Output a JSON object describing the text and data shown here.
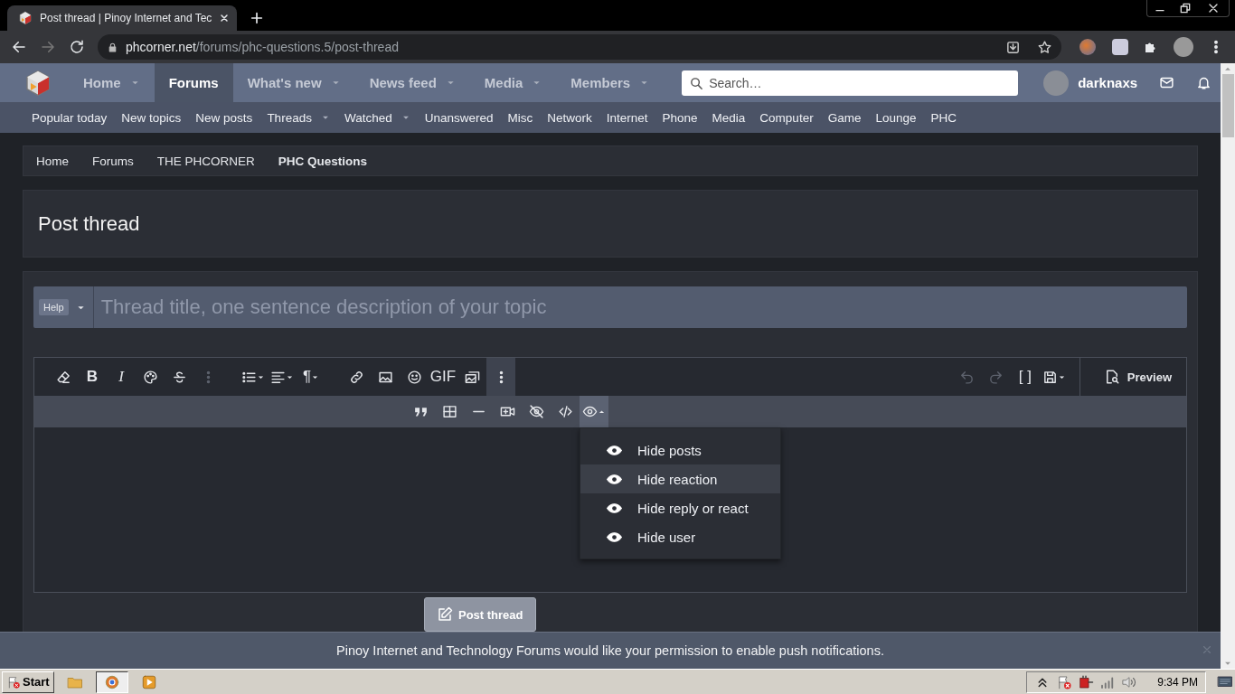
{
  "browser": {
    "tab_title": "Post thread | Pinoy Internet and Tec",
    "url_domain": "phcorner.net",
    "url_path": "/forums/phc-questions.5/post-thread"
  },
  "nav": {
    "items": [
      {
        "label": "Home",
        "selected": false,
        "has_menu": true
      },
      {
        "label": "Forums",
        "selected": true,
        "has_menu": false
      },
      {
        "label": "What's new",
        "selected": false,
        "has_menu": true
      },
      {
        "label": "News feed",
        "selected": false,
        "has_menu": true
      },
      {
        "label": "Media",
        "selected": false,
        "has_menu": true
      },
      {
        "label": "Members",
        "selected": false,
        "has_menu": true
      }
    ],
    "search_placeholder": "Search…",
    "username": "darknaxs"
  },
  "subnav": [
    {
      "label": "Popular today",
      "has_menu": false
    },
    {
      "label": "New topics",
      "has_menu": false
    },
    {
      "label": "New posts",
      "has_menu": false
    },
    {
      "label": "Threads",
      "has_menu": true
    },
    {
      "label": "Watched",
      "has_menu": true
    },
    {
      "label": "Unanswered",
      "has_menu": false
    },
    {
      "label": "Misc",
      "has_menu": false
    },
    {
      "label": "Network",
      "has_menu": false
    },
    {
      "label": "Internet",
      "has_menu": false
    },
    {
      "label": "Phone",
      "has_menu": false
    },
    {
      "label": "Media",
      "has_menu": false
    },
    {
      "label": "Computer",
      "has_menu": false
    },
    {
      "label": "Game",
      "has_menu": false
    },
    {
      "label": "Lounge",
      "has_menu": false
    },
    {
      "label": "PHC",
      "has_menu": false
    }
  ],
  "breadcrumbs": [
    {
      "label": "Home",
      "current": false
    },
    {
      "label": "Forums",
      "current": false
    },
    {
      "label": "THE PHCORNER",
      "current": false
    },
    {
      "label": "PHC Questions",
      "current": true
    }
  ],
  "page_title": "Post thread",
  "form": {
    "prefix": "Help",
    "title_placeholder": "Thread title, one sentence description of your topic",
    "toolbar_left": [
      {
        "kind": "eraser"
      },
      {
        "kind": "bold",
        "glyph": "B"
      },
      {
        "kind": "italic",
        "glyph": "I"
      },
      {
        "kind": "palette"
      },
      {
        "kind": "strike"
      },
      {
        "kind": "vdots",
        "disabled": true
      },
      {
        "kind": "gap"
      },
      {
        "kind": "list",
        "has_menu": true
      },
      {
        "kind": "align",
        "has_menu": true
      },
      {
        "kind": "pilcrow",
        "glyph": "¶",
        "has_menu": true
      },
      {
        "kind": "gap"
      },
      {
        "kind": "link"
      },
      {
        "kind": "image"
      },
      {
        "kind": "smile"
      },
      {
        "kind": "gif",
        "glyph": "GIF"
      },
      {
        "kind": "gallery"
      },
      {
        "kind": "vdots",
        "active": true
      }
    ],
    "toolbar_right": [
      {
        "kind": "undo",
        "disabled": true
      },
      {
        "kind": "redo",
        "disabled": true
      },
      {
        "kind": "brackets",
        "glyph": "[ ]"
      },
      {
        "kind": "floppy",
        "has_menu": true
      }
    ],
    "toolbar_more": [
      {
        "kind": "quote"
      },
      {
        "kind": "table"
      },
      {
        "kind": "hr"
      },
      {
        "kind": "video"
      },
      {
        "kind": "eyeoff"
      },
      {
        "kind": "code"
      },
      {
        "kind": "eye",
        "has_menu": true,
        "active": true,
        "expanded": true
      }
    ],
    "preview": "Preview",
    "hide_menu": [
      {
        "label": "Hide posts",
        "selected": false
      },
      {
        "label": "Hide reaction",
        "selected": true
      },
      {
        "label": "Hide reply or react",
        "selected": false
      },
      {
        "label": "Hide user",
        "selected": false
      }
    ],
    "submit": "Post thread"
  },
  "notice": "Pinoy Internet and Technology Forums would like your permission to enable push notifications.",
  "taskbar": {
    "start": "Start",
    "clock": "9:34 PM"
  }
}
